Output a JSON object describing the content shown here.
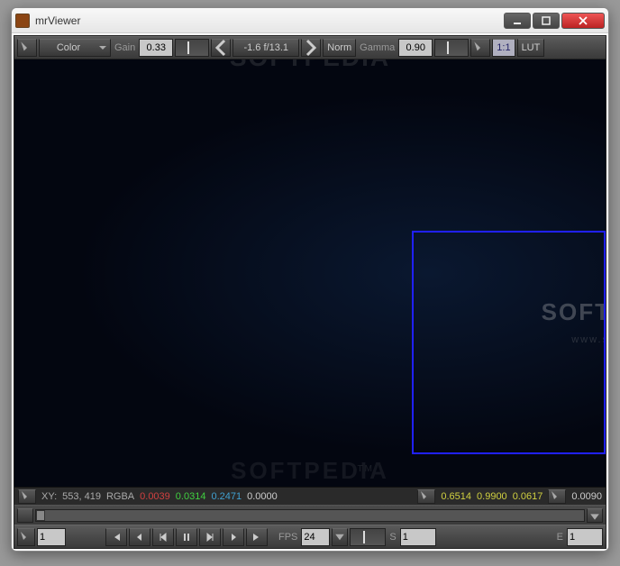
{
  "window": {
    "title": "mrViewer"
  },
  "toolbar": {
    "color_menu": "Color",
    "gain_label": "Gain",
    "gain_value": "0.33",
    "fstop_value": "-1.6  f/13.1",
    "norm_label": "Norm",
    "gamma_label": "Gamma",
    "gamma_value": "0.90",
    "ratio_label": "1:1",
    "lut_label": "LUT"
  },
  "watermarks": {
    "top": "SOFTPEDIA",
    "right": "SOFT",
    "sub": "www.s",
    "bottom": "SOFTPEDIA",
    "tag": "TM"
  },
  "info": {
    "xy_label": "XY:",
    "xy_value": "553, 419",
    "rgba_label": "RGBA",
    "r": "0.0039",
    "g": "0.0314",
    "b": "0.2471",
    "a": "0.0000",
    "h": "0.6514",
    "s": "0.9900",
    "v": "0.0617",
    "l": "0.0090"
  },
  "playbar": {
    "frame_input": "1",
    "fps_label": "FPS",
    "fps_value": "24",
    "s_label": "S",
    "s_value": "1",
    "e_label": "E",
    "e_value": "1"
  }
}
